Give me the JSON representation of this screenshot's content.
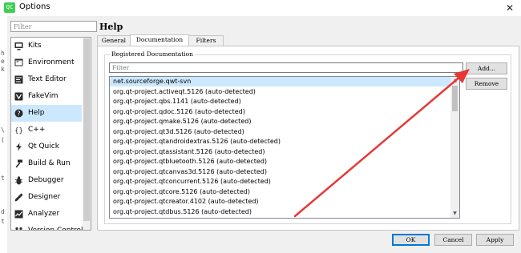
{
  "window": {
    "app_icon_text": "QC",
    "title": "Options",
    "close_glyph": "✕"
  },
  "left_strip": [
    "h",
    "e",
    "k",
    "\\",
    "(",
    "t",
    "d",
    "t"
  ],
  "sidebar": {
    "filter_placeholder": "Filter",
    "items": [
      {
        "label": "Kits",
        "icon": "monitor-icon",
        "selected": false
      },
      {
        "label": "Environment",
        "icon": "environment-icon",
        "selected": false
      },
      {
        "label": "Text Editor",
        "icon": "text-editor-icon",
        "selected": false
      },
      {
        "label": "FakeVim",
        "icon": "fakevim-icon",
        "selected": false
      },
      {
        "label": "Help",
        "icon": "help-icon",
        "selected": true
      },
      {
        "label": "C++",
        "icon": "braces-icon",
        "selected": false
      },
      {
        "label": "Qt Quick",
        "icon": "qt-quick-icon",
        "selected": false
      },
      {
        "label": "Build & Run",
        "icon": "hammer-icon",
        "selected": false
      },
      {
        "label": "Debugger",
        "icon": "bug-icon",
        "selected": false
      },
      {
        "label": "Designer",
        "icon": "pen-icon",
        "selected": false
      },
      {
        "label": "Analyzer",
        "icon": "analyzer-icon",
        "selected": false
      },
      {
        "label": "Version Control",
        "icon": "version-control-icon",
        "selected": false
      }
    ]
  },
  "page": {
    "title": "Help",
    "tabs": [
      {
        "label": "General",
        "active": false
      },
      {
        "label": "Documentation",
        "active": true
      },
      {
        "label": "Filters",
        "active": false
      }
    ],
    "group_title": "Registered Documentation",
    "filter_placeholder": "Filter",
    "add_button": "Add...",
    "remove_button": "Remove",
    "docs": [
      "net.sourceforge.qwt-svn",
      "org.qt-project.activeqt.5126 (auto-detected)",
      "org.qt-project.qbs.1141 (auto-detected)",
      "org.qt-project.qdoc.5126 (auto-detected)",
      "org.qt-project.qmake.5126 (auto-detected)",
      "org.qt-project.qt3d.5126 (auto-detected)",
      "org.qt-project.qtandroidextras.5126 (auto-detected)",
      "org.qt-project.qtassistant.5126 (auto-detected)",
      "org.qt-project.qtbluetooth.5126 (auto-detected)",
      "org.qt-project.qtcanvas3d.5126 (auto-detected)",
      "org.qt-project.qtconcurrent.5126 (auto-detected)",
      "org.qt-project.qtcore.5126 (auto-detected)",
      "org.qt-project.qtcreator.4102 (auto-detected)",
      "org.qt-project.qtdbus.5126 (auto-detected)"
    ],
    "selected_doc_index": 0
  },
  "footer": {
    "ok": "OK",
    "cancel": "Cancel",
    "apply": "Apply"
  },
  "colors": {
    "selection": "#cce8ff",
    "annotation_arrow": "#e53935",
    "qt_green": "#41cd52"
  }
}
